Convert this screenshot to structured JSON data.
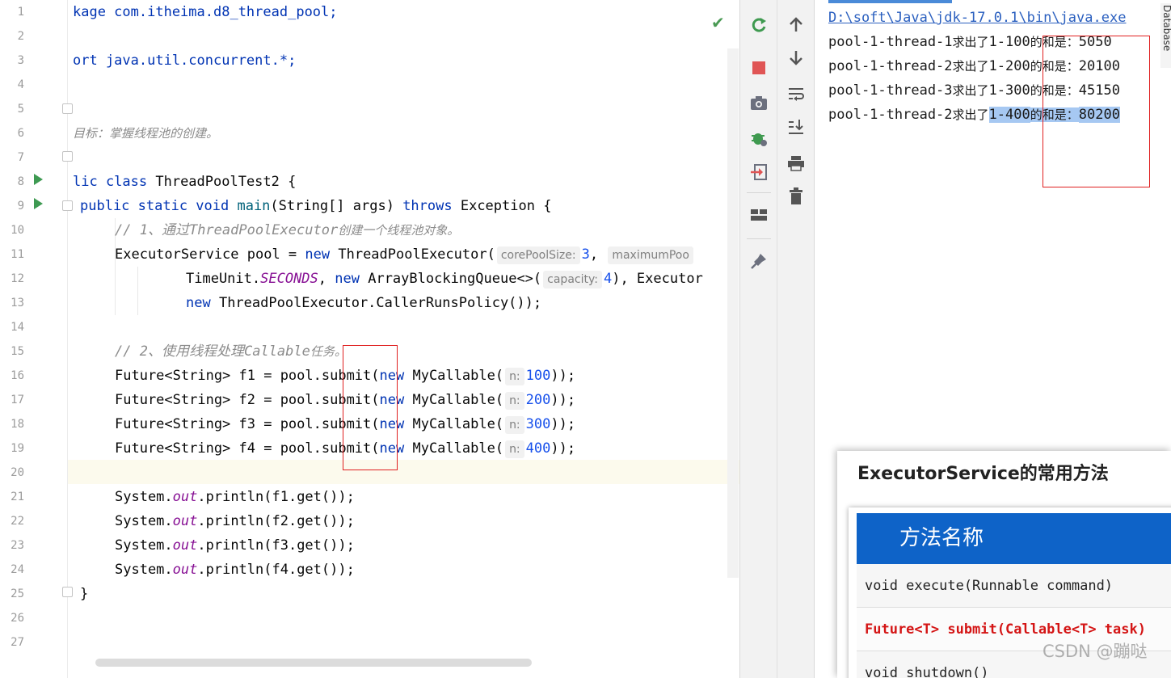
{
  "editor": {
    "line_numbers": [
      "1",
      "2",
      "3",
      "4",
      "5",
      "6",
      "7",
      "8",
      "9",
      "10",
      "11",
      "12",
      "13",
      "14",
      "15",
      "16",
      "17",
      "18",
      "19",
      "20",
      "21",
      "22",
      "23",
      "24",
      "25",
      "26",
      "27"
    ],
    "lines": {
      "l1": "kage com.itheima.d8_thread_pool;",
      "l3": "ort java.util.concurrent.*;",
      "l6": "目标：掌握线程池的创建。",
      "l8_a": "lic class",
      "l8_b": " ThreadPoolTest2 {",
      "l9_a": "public static void",
      "l9_b": " main",
      "l9_c": "(String[] args) ",
      "l9_d": "throws",
      "l9_e": " Exception {",
      "l10_a": "// 1、通过",
      "l10_b": "ThreadPoolExecutor",
      "l10_c": "创建一个线程池对象。",
      "l11_a": "ExecutorService pool = ",
      "l11_b": "new",
      "l11_c": " ThreadPoolExecutor(",
      "l11_hint": "corePoolSize:",
      "l11_d": "3",
      "l11_e": ",",
      "l11_hint2": "maximumPoo",
      "l12_a": "TimeUnit.",
      "l12_b": "SECONDS",
      "l12_c": ", ",
      "l12_d": "new",
      "l12_e": " ArrayBlockingQueue<>(",
      "l12_hint": "capacity:",
      "l12_f": "4",
      "l12_g": "), Executor",
      "l13_a": "new",
      "l13_b": " ThreadPoolExecutor.CallerRunsPolicy());",
      "l15_a": "// 2、使用线程处理",
      "l15_b": "Callable",
      "l15_c": "任务。",
      "submits": [
        {
          "a": "Future<String> f1 = pool.submit(",
          "b": "new",
          "c": " MyCallable(",
          "hint": "n:",
          "num": "100",
          "d": "));"
        },
        {
          "a": "Future<String> f2 = pool.submit(",
          "b": "new",
          "c": " MyCallable(",
          "hint": "n:",
          "num": "200",
          "d": "));"
        },
        {
          "a": "Future<String> f3 = pool.submit(",
          "b": "new",
          "c": " MyCallable(",
          "hint": "n:",
          "num": "300",
          "d": "));"
        },
        {
          "a": "Future<String> f4 = pool.submit(",
          "b": "new",
          "c": " MyCallable(",
          "hint": "n:",
          "num": "400",
          "d": "));"
        }
      ],
      "prints": [
        {
          "a": "System.",
          "b": "out",
          "c": ".println(f1.get());"
        },
        {
          "a": "System.",
          "b": "out",
          "c": ".println(f2.get());"
        },
        {
          "a": "System.",
          "b": "out",
          "c": ".println(f3.get());"
        },
        {
          "a": "System.",
          "b": "out",
          "c": ".println(f4.get());"
        }
      ],
      "l25": "}"
    },
    "check_icon": "✔"
  },
  "toolbar1": {
    "icons": [
      "rerun-icon",
      "stop-icon",
      "camera-icon",
      "debug-bug-icon",
      "exit-icon",
      "layout-icon",
      "pin-icon"
    ]
  },
  "toolbar2": {
    "icons": [
      "arrow-up-icon",
      "arrow-down-icon",
      "soft-wrap-icon",
      "scroll-to-end-icon",
      "print-icon",
      "trash-icon"
    ]
  },
  "console": {
    "command": "D:\\soft\\Java\\jdk-17.0.1\\bin\\java.exe",
    "outputs": [
      {
        "thread": "pool-1-thread-1",
        "mid": "求出了",
        "range": "1-100",
        "label": "的和是：",
        "value": "5050"
      },
      {
        "thread": "pool-1-thread-2",
        "mid": "求出了",
        "range": "1-200",
        "label": "的和是：",
        "value": "20100"
      },
      {
        "thread": "pool-1-thread-3",
        "mid": "求出了",
        "range": "1-300",
        "label": "的和是：",
        "value": "45150"
      },
      {
        "thread": "pool-1-thread-2",
        "mid": "求出了",
        "range": "1-400",
        "label": "的和是：",
        "value": "80200"
      }
    ],
    "side_label": "Database"
  },
  "slide": {
    "title": "ExecutorService的常用方法",
    "header": "方法名称",
    "rows": [
      "void execute(Runnable command)",
      "Future<T> submit(Callable<T> task)",
      "void shutdown()"
    ]
  },
  "watermark": "CSDN @蹦哒"
}
